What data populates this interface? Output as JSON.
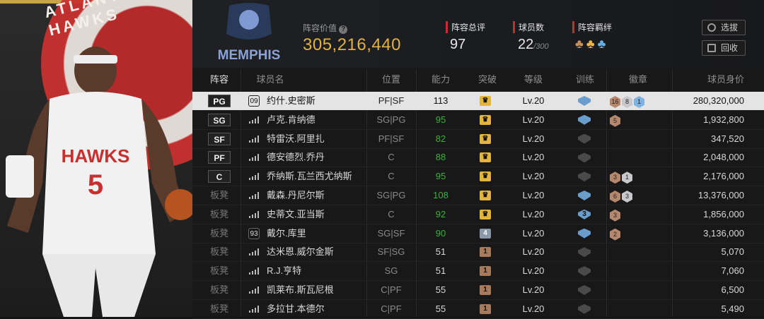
{
  "header": {
    "lineup_value_label": "阵容价值",
    "lineup_value": "305,216,440",
    "rating_label": "阵容总评",
    "rating": "97",
    "players_label": "球员数",
    "players_count": "22",
    "players_max": "/300",
    "chemistry_label": "阵容羁绊",
    "team_logo_text": "MEMPHIS",
    "btn_select": "选拔",
    "btn_recycle": "回收"
  },
  "left_panel": {
    "logo_text": "ATLANTA HAWKS",
    "jersey_text": "HAWKS",
    "jersey_number": "5"
  },
  "columns": [
    "阵容",
    "球员名",
    "位置",
    "能力",
    "突破",
    "等级",
    "训练",
    "徽章",
    "球员身价"
  ],
  "rows": [
    {
      "slot": "PG",
      "is_bench": false,
      "selected": true,
      "num": "09",
      "name": "约什.史密斯",
      "pos": "PF|SF",
      "ability": "113",
      "green": false,
      "break": "crown",
      "level": "Lv.20",
      "train": "on",
      "badges": [
        {
          "t": "bronze",
          "v": "16"
        },
        {
          "t": "silver",
          "v": "8"
        },
        {
          "t": "blue",
          "v": "1"
        }
      ],
      "salary": "280,320,000"
    },
    {
      "slot": "SG",
      "is_bench": false,
      "selected": false,
      "num": "",
      "name": "卢克.肯纳德",
      "pos": "SG|PG",
      "ability": "95",
      "green": true,
      "break": "crown",
      "level": "Lv.20",
      "train": "on",
      "badges": [
        {
          "t": "bronze",
          "v": "5"
        }
      ],
      "salary": "1,932,800"
    },
    {
      "slot": "SF",
      "is_bench": false,
      "selected": false,
      "num": "",
      "name": "特雷沃.阿里扎",
      "pos": "PF|SF",
      "ability": "82",
      "green": true,
      "break": "crown",
      "level": "Lv.20",
      "train": "off",
      "badges": [],
      "salary": "347,520"
    },
    {
      "slot": "PF",
      "is_bench": false,
      "selected": false,
      "num": "",
      "name": "德安德烈.乔丹",
      "pos": "C",
      "ability": "88",
      "green": true,
      "break": "crown",
      "level": "Lv.20",
      "train": "off",
      "badges": [],
      "salary": "2,048,000"
    },
    {
      "slot": "C",
      "is_bench": false,
      "selected": false,
      "num": "",
      "name": "乔纳斯.瓦兰西尤纳斯",
      "pos": "C",
      "ability": "95",
      "green": true,
      "break": "crown",
      "level": "Lv.20",
      "train": "off",
      "badges": [
        {
          "t": "bronze",
          "v": "3"
        },
        {
          "t": "silver",
          "v": "1"
        }
      ],
      "salary": "2,176,000"
    },
    {
      "slot": "板凳",
      "is_bench": true,
      "selected": false,
      "num": "",
      "name": "戴森.丹尼尔斯",
      "pos": "SG|PG",
      "ability": "108",
      "green": true,
      "break": "crown",
      "level": "Lv.20",
      "train": "on",
      "badges": [
        {
          "t": "bronze",
          "v": "6"
        },
        {
          "t": "silver",
          "v": "3"
        }
      ],
      "salary": "13,376,000"
    },
    {
      "slot": "板凳",
      "is_bench": true,
      "selected": false,
      "num": "",
      "name": "史蒂文.亚当斯",
      "pos": "C",
      "ability": "92",
      "green": true,
      "break": "crown",
      "level": "Lv.20",
      "train": "three",
      "badges": [
        {
          "t": "bronze",
          "v": "3"
        }
      ],
      "salary": "1,856,000"
    },
    {
      "slot": "板凳",
      "is_bench": true,
      "selected": false,
      "num": "93",
      "name": "戴尔.库里",
      "pos": "SG|SF",
      "ability": "90",
      "green": true,
      "break": "4",
      "level": "Lv.20",
      "train": "on",
      "badges": [
        {
          "t": "bronze",
          "v": "2"
        }
      ],
      "salary": "3,136,000"
    },
    {
      "slot": "板凳",
      "is_bench": true,
      "selected": false,
      "num": "",
      "name": "达米恩.威尔金斯",
      "pos": "SF|SG",
      "ability": "51",
      "green": false,
      "break": "1",
      "level": "Lv.20",
      "train": "off",
      "badges": [],
      "salary": "5,070"
    },
    {
      "slot": "板凳",
      "is_bench": true,
      "selected": false,
      "num": "",
      "name": "R.J.亨特",
      "pos": "SG",
      "ability": "51",
      "green": false,
      "break": "1",
      "level": "Lv.20",
      "train": "off",
      "badges": [],
      "salary": "7,060"
    },
    {
      "slot": "板凳",
      "is_bench": true,
      "selected": false,
      "num": "",
      "name": "凯莱布.斯瓦尼根",
      "pos": "C|PF",
      "ability": "55",
      "green": false,
      "break": "1",
      "level": "Lv.20",
      "train": "off",
      "badges": [],
      "salary": "6,500"
    },
    {
      "slot": "板凳",
      "is_bench": true,
      "selected": false,
      "num": "",
      "name": "多拉甘.本德尔",
      "pos": "C|PF",
      "ability": "55",
      "green": false,
      "break": "1",
      "level": "Lv.20",
      "train": "off",
      "badges": [],
      "salary": "5,490"
    }
  ]
}
